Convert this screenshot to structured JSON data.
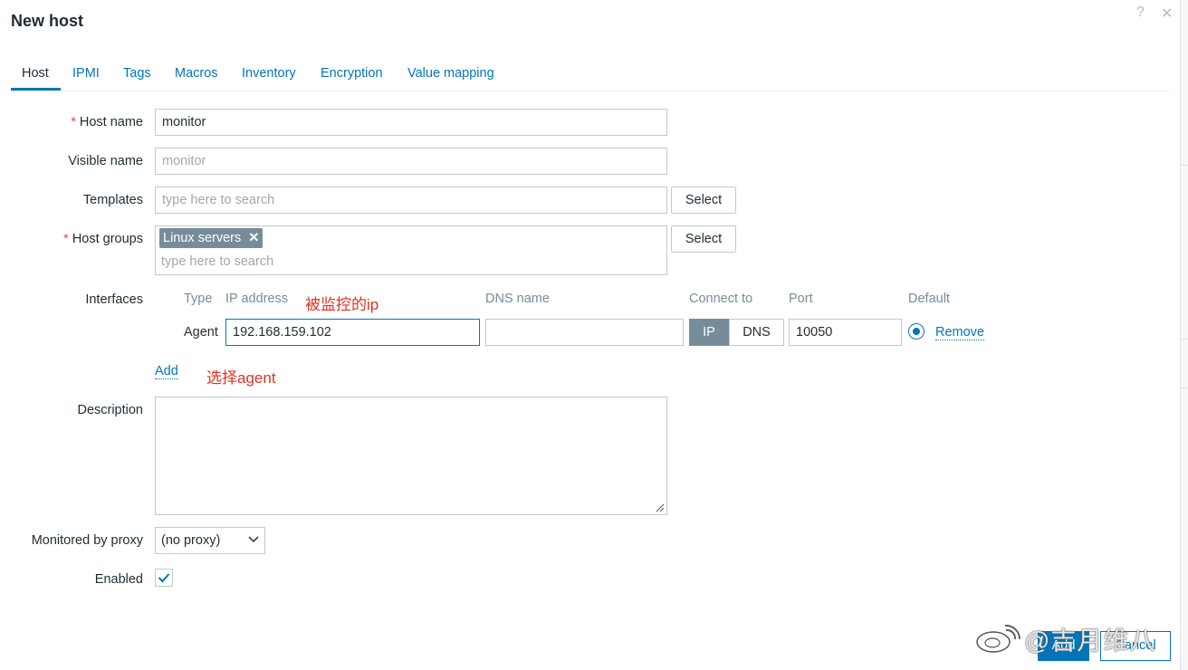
{
  "dialog": {
    "title": "New host",
    "help_glyph": "?",
    "close_glyph": "✕"
  },
  "tabs": [
    {
      "label": "Host",
      "active": true
    },
    {
      "label": "IPMI"
    },
    {
      "label": "Tags"
    },
    {
      "label": "Macros"
    },
    {
      "label": "Inventory"
    },
    {
      "label": "Encryption"
    },
    {
      "label": "Value mapping"
    }
  ],
  "form": {
    "required_mark": "*",
    "host_name": {
      "label": "Host name",
      "value": "monitor"
    },
    "visible_name": {
      "label": "Visible name",
      "placeholder": "monitor"
    },
    "templates": {
      "label": "Templates",
      "placeholder": "type here to search",
      "select_label": "Select"
    },
    "host_groups": {
      "label": "Host groups",
      "chip": "Linux servers",
      "chip_remove": "✕",
      "placeholder": "type here to search",
      "select_label": "Select"
    },
    "interfaces": {
      "label": "Interfaces",
      "columns": {
        "type": "Type",
        "ip": "IP address",
        "dns": "DNS name",
        "connect": "Connect to",
        "port": "Port",
        "default": "Default"
      },
      "row": {
        "type": "Agent",
        "ip": "192.168.159.102",
        "dns": "",
        "connect_ip": "IP",
        "connect_dns": "DNS",
        "connect_selected": "IP",
        "port": "10050",
        "default_selected": true,
        "remove": "Remove"
      },
      "add": "Add"
    },
    "description": {
      "label": "Description",
      "value": ""
    },
    "proxy": {
      "label": "Monitored by proxy",
      "value": "(no proxy)"
    },
    "enabled": {
      "label": "Enabled",
      "checked": true
    }
  },
  "annotations": {
    "ip_note": "被监控的ip",
    "agent_note": "选择agent"
  },
  "footer": {
    "add_label": "Add",
    "cancel_label": "Cancel"
  },
  "watermark": "@吉月维八",
  "colors": {
    "link": "#0275b8",
    "annotation": "#e0321e",
    "required": "#d64e4e",
    "chip_bg": "#768d99"
  }
}
